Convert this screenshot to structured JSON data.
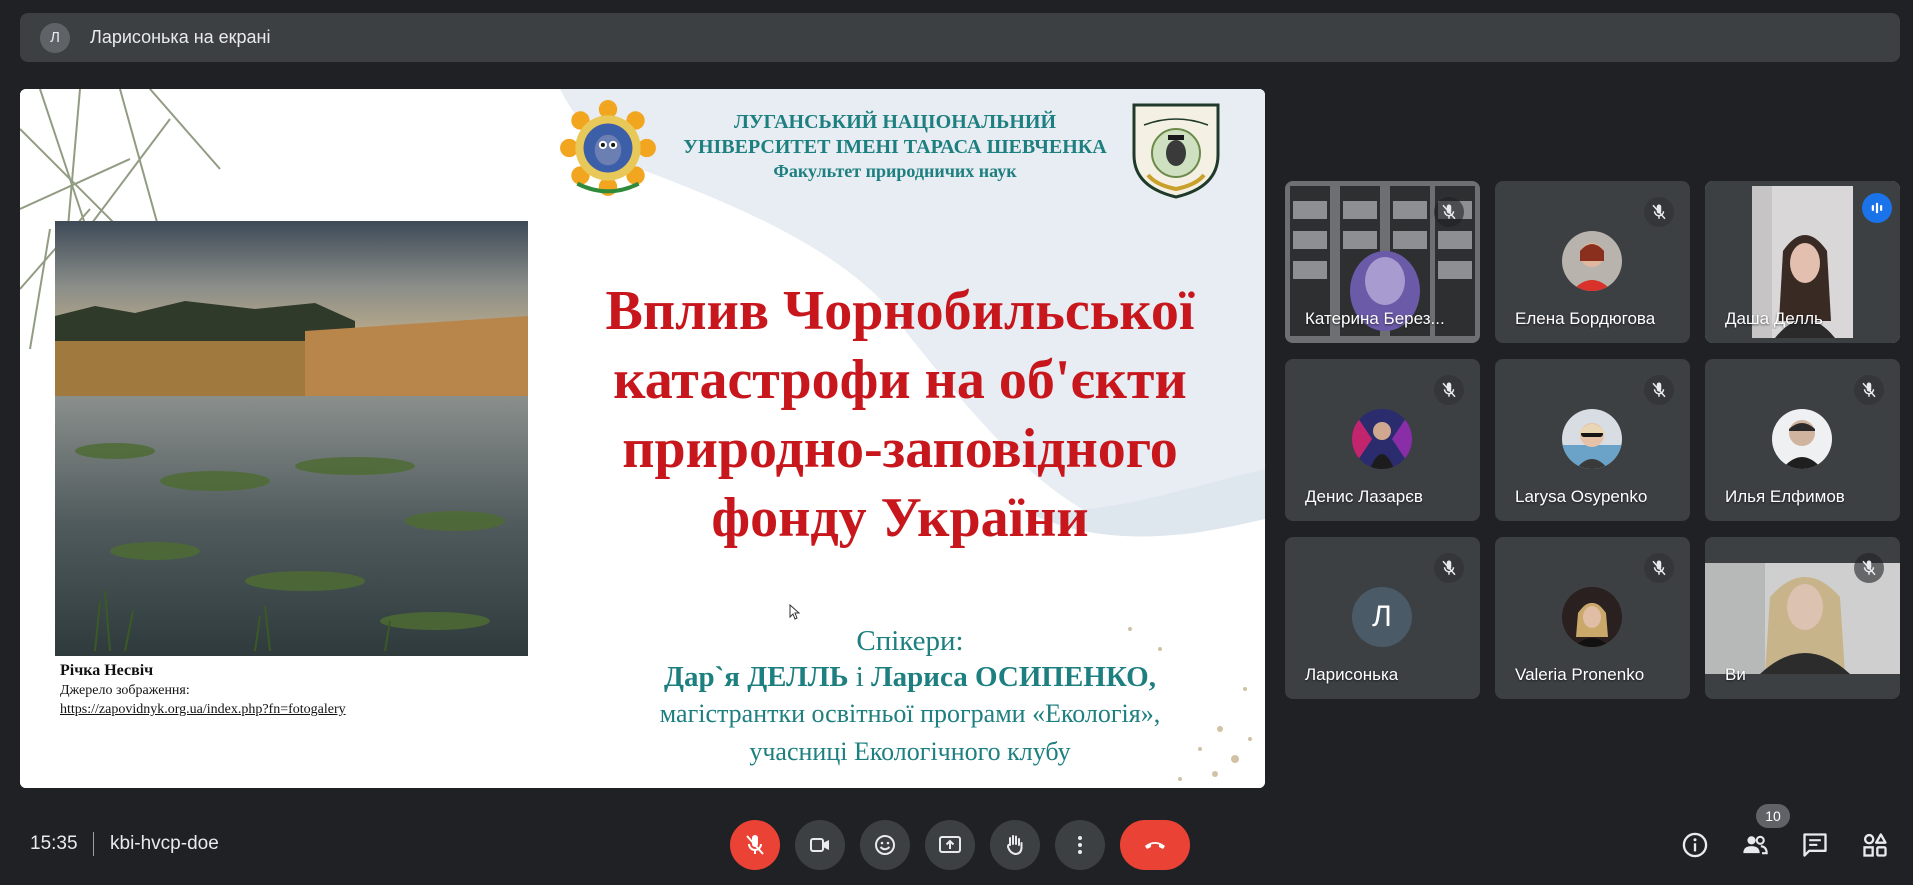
{
  "presenter_bar": {
    "avatar_letter": "Л",
    "label": "Ларисонька на екрані"
  },
  "slide": {
    "university_line1": "ЛУГАНСЬКИЙ НАЦІОНАЛЬНИЙ",
    "university_line2": "УНІВЕРСИТЕТ ІМЕНІ ТАРАСА ШЕВЧЕНКА",
    "university_line3": "Факультет природничих наук",
    "title_lines": [
      "Вплив Чорнобильської",
      "катастрофи на об'єкти",
      "природно-заповідного",
      "фонду України"
    ],
    "photo_caption": "Річка Несвіч",
    "photo_source_label": "Джерело зображення:",
    "photo_source_url": "https://zapovidnyk.org.ua/index.php?fn=fotogalery",
    "speakers_label": "Спікери:",
    "speaker1": "Дар`я ДЕЛЛЬ",
    "speakers_and": " і ",
    "speaker2": "Лариса ОСИПЕНКО,",
    "speakers_line3": "магістрантки освітньої програми «Екологія»,",
    "speakers_line4": "учасниці Екологічного клубу",
    "title_color": "#c8161d",
    "accent_color": "#1d7f7f"
  },
  "participants": [
    {
      "name": "Катерина Березина",
      "display": "Катерина Берез...",
      "type": "video",
      "muted": true
    },
    {
      "name": "Елена Бордюгова",
      "type": "avatar",
      "muted": true
    },
    {
      "name": "Даша Делль",
      "type": "video",
      "speaking": true
    },
    {
      "name": "Денис Лазарєв",
      "type": "avatar",
      "muted": true
    },
    {
      "name": "Larysa Osypenko",
      "type": "avatar",
      "muted": true
    },
    {
      "name": "Илья Елфимов",
      "type": "avatar",
      "muted": true
    },
    {
      "name": "Ларисонька",
      "type": "letter",
      "letter": "Л",
      "muted": true
    },
    {
      "name": "Valeria Pronenko",
      "type": "avatar",
      "muted": true
    },
    {
      "name": "Ви",
      "type": "video",
      "muted": true
    }
  ],
  "bottom_bar": {
    "time": "15:35",
    "meeting_code": "kbi-hvcp-doe",
    "participant_count": "10",
    "danger_color": "#ea4335",
    "active_color": "#1a73e8"
  },
  "icons": [
    "mic-off-icon",
    "camera-icon",
    "emoji-icon",
    "present-screen-icon",
    "raise-hand-icon",
    "more-options-icon",
    "hang-up-icon",
    "info-icon",
    "people-icon",
    "chat-icon",
    "activities-icon"
  ]
}
